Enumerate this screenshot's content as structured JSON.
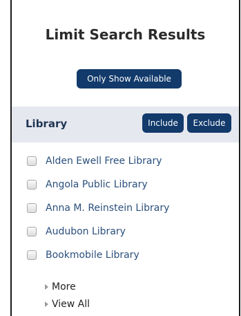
{
  "panel": {
    "title": "Limit Search Results",
    "only_show_available_label": "Only Show Available"
  },
  "library_facet": {
    "title": "Library",
    "include_label": "Include",
    "exclude_label": "Exclude",
    "items": [
      {
        "label": "Alden Ewell Free Library",
        "checked": false
      },
      {
        "label": "Angola Public Library",
        "checked": false
      },
      {
        "label": "Anna M. Reinstein Library",
        "checked": false
      },
      {
        "label": "Audubon Library",
        "checked": false
      },
      {
        "label": "Bookmobile Library",
        "checked": false
      }
    ],
    "more_label": "More",
    "view_all_label": "View All"
  },
  "colors": {
    "button_bg": "#123a6b",
    "header_bg": "#e5e8ee",
    "link_text": "#2a4f7c"
  }
}
